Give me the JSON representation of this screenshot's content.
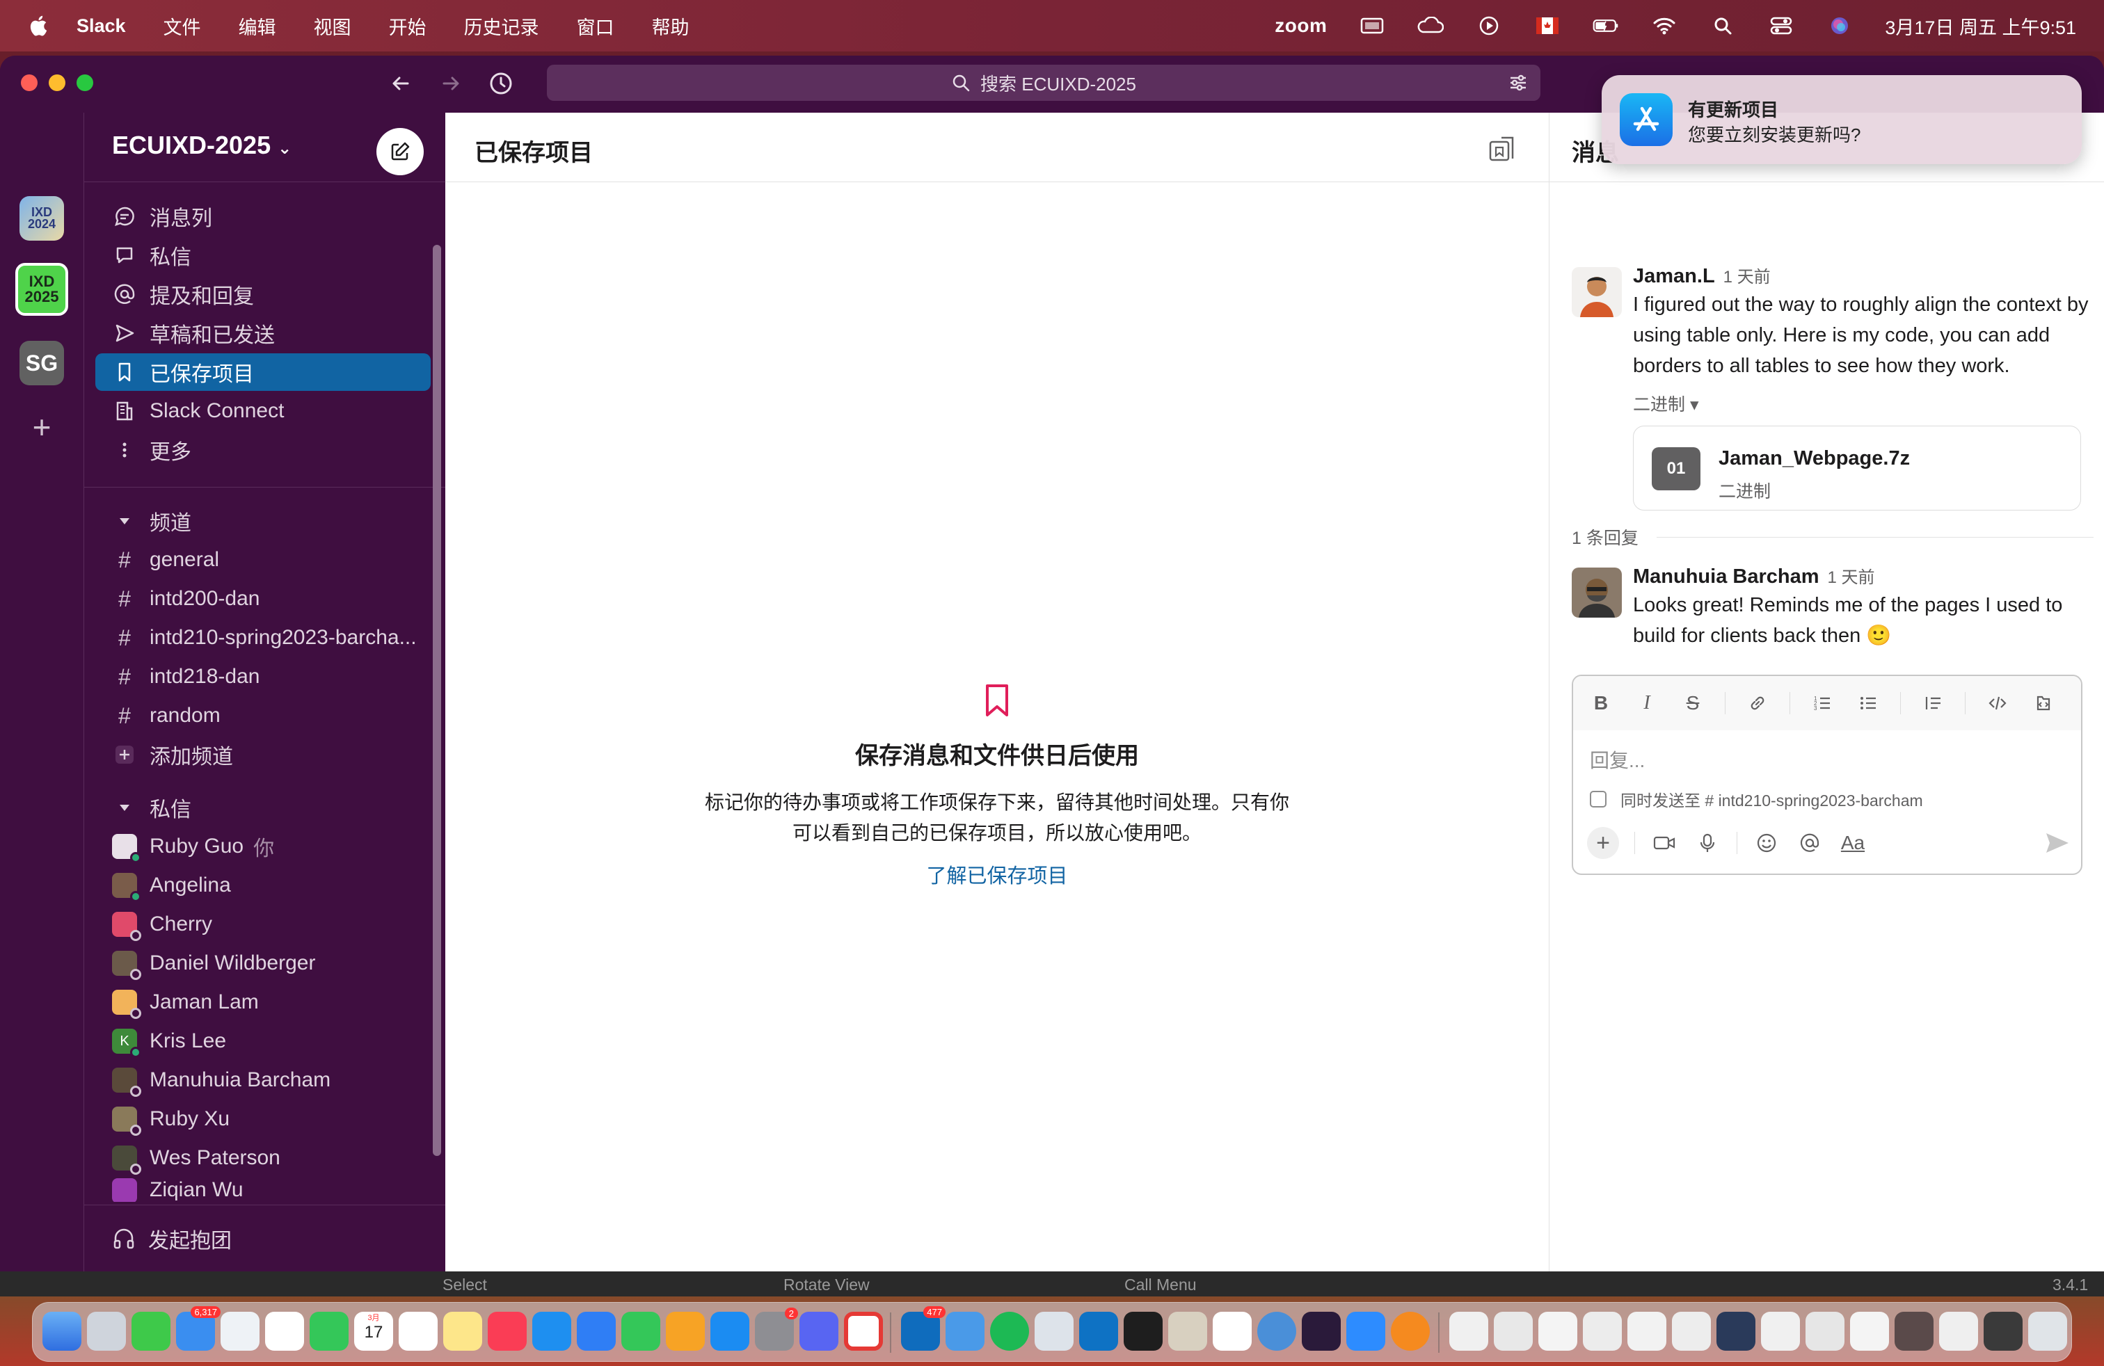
{
  "menubar": {
    "app_name": "Slack",
    "menus": [
      "文件",
      "编辑",
      "视图",
      "开始",
      "历史记录",
      "窗口",
      "帮助"
    ],
    "zoom_label": "zoom",
    "clock": "3月17日 周五 上午9:51"
  },
  "search": {
    "placeholder": "搜索 ECUIXD-2025"
  },
  "workspaces": [
    {
      "label": "IXD 2024"
    },
    {
      "label": "IXD 2025"
    },
    {
      "label": "SG"
    }
  ],
  "sidebar": {
    "workspace_name": "ECUIXD-2025",
    "nav": [
      {
        "label": "消息列",
        "icon": "threads-icon"
      },
      {
        "label": "私信",
        "icon": "dm-icon"
      },
      {
        "label": "提及和回复",
        "icon": "mention-icon"
      },
      {
        "label": "草稿和已发送",
        "icon": "send-icon"
      },
      {
        "label": "已保存项目",
        "icon": "bookmark-icon",
        "active": true
      },
      {
        "label": "Slack Connect",
        "icon": "building-icon"
      },
      {
        "label": "更多",
        "icon": "more-icon"
      }
    ],
    "channels_header": "频道",
    "channels": [
      "general",
      "intd200-dan",
      "intd210-spring2023-barcha...",
      "intd218-dan",
      "random"
    ],
    "add_channel": "添加频道",
    "dms_header": "私信",
    "dms": [
      {
        "name": "Ruby Guo",
        "you": "你",
        "online": true,
        "color": "#e8e0e8"
      },
      {
        "name": "Angelina",
        "online": true,
        "color": "#7a5c4a"
      },
      {
        "name": "Cherry",
        "online": false,
        "color": "#e04a6a"
      },
      {
        "name": "Daniel Wildberger",
        "online": false,
        "color": "#6b5a4a"
      },
      {
        "name": "Jaman Lam",
        "online": false,
        "color": "#f2b35a"
      },
      {
        "name": "Kris Lee",
        "online": true,
        "color": "#3e8a3a",
        "initial": "K"
      },
      {
        "name": "Manuhuia Barcham",
        "online": false,
        "color": "#5a4a3a"
      },
      {
        "name": "Ruby Xu",
        "online": false,
        "color": "#8a7a5a"
      },
      {
        "name": "Wes Paterson",
        "online": false,
        "color": "#4a4a3a"
      },
      {
        "name": "Ziqian Wu",
        "online": false,
        "color": "#9a3ab0"
      }
    ],
    "huddle": "发起抱团"
  },
  "main": {
    "title": "已保存项目",
    "empty_title": "保存消息和文件供日后使用",
    "empty_desc": "标记你的待办事项或将工作项保存下来，留待其他时间处理。只有你可以看到自己的已保存项目，所以放心使用吧。",
    "empty_link": "了解已保存项目"
  },
  "thread": {
    "title": "消息",
    "messages": [
      {
        "author": "Jaman.L",
        "time": "1 天前",
        "text": "I figured out the way to roughly align the context by using table only. Here is my code, you can add borders to all tables to see how they work.",
        "file_label": "二进制 ▾",
        "file": {
          "icon_text": "01",
          "name": "Jaman_Webpage.7z",
          "type": "二进制"
        }
      },
      {
        "author": "Manuhuia Barcham",
        "time": "1 天前",
        "text": "Looks great! Reminds me of the pages I used to build for clients back then 🙂"
      }
    ],
    "replies_label": "1 条回复",
    "composer": {
      "placeholder": "回复...",
      "also_send": "同时发送至 # intd210-spring2023-barcham"
    }
  },
  "notification": {
    "title": "有更新项目",
    "body": "您要立刻安装更新吗?"
  },
  "footer": {
    "select": "Select",
    "rotate": "Rotate View",
    "call": "Call Menu",
    "version": "3.4.1"
  },
  "dock": {
    "mail_badge": "6,317",
    "settings_badge": "2",
    "outlook_badge": "477",
    "calendar_day": "17",
    "calendar_month": "3月"
  }
}
